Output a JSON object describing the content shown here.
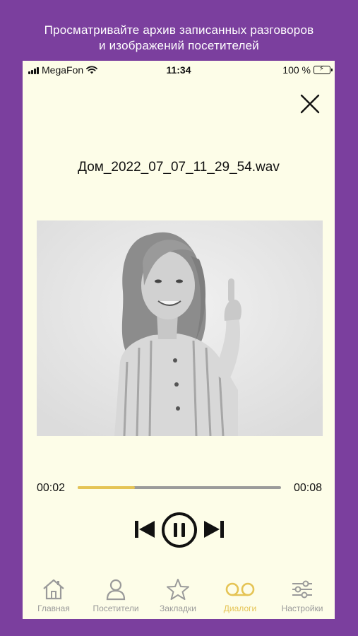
{
  "promo": {
    "line1": "Просматривайте архив записанных разговоров",
    "line2": "и изображений посетителей"
  },
  "status_bar": {
    "carrier": "MegaFon",
    "time": "11:34",
    "battery": "100 %"
  },
  "player": {
    "filename": "Дом_2022_07_07_11_29_54.wav",
    "current_time": "00:02",
    "total_time": "00:08",
    "progress_fraction": 0.28,
    "state": "playing"
  },
  "tabs": [
    {
      "label": "Главная",
      "icon": "home-icon"
    },
    {
      "label": "Посетители",
      "icon": "person-icon"
    },
    {
      "label": "Закладки",
      "icon": "star-icon"
    },
    {
      "label": "Диалоги",
      "icon": "voicemail-icon",
      "active": true
    },
    {
      "label": "Настройки",
      "icon": "sliders-icon"
    }
  ],
  "colors": {
    "background": "#7b3f9e",
    "screen": "#fdfde8",
    "accent": "#e5c455",
    "inactive": "#9a9a9a"
  }
}
